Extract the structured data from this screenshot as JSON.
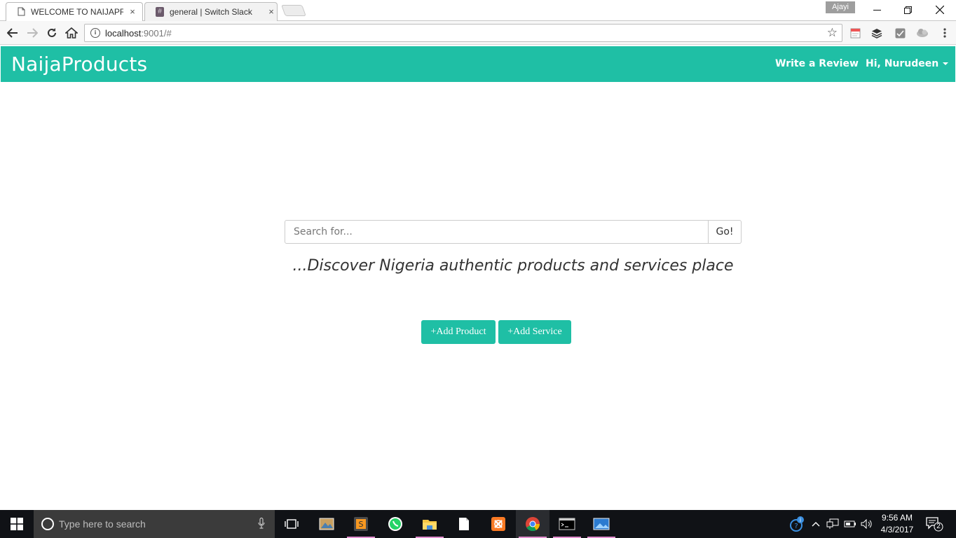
{
  "browser": {
    "tabs": [
      {
        "label": "WELCOME TO NAIJAPRO",
        "active": true
      },
      {
        "label": "general | Switch Slack",
        "active": false
      }
    ],
    "tab_close_glyph": "×",
    "profile_name": "Ajayi",
    "window_controls": {
      "minimize": "—",
      "restore": "❐",
      "close": "✕"
    },
    "address": {
      "host": "localhost",
      "path": ":9001/#"
    },
    "info_glyph": "i",
    "bookmark_glyph": "☆"
  },
  "navbar": {
    "brand": "NaijaProducts",
    "write_review": "Write a Review",
    "user_greeting": "Hi, Nurudeen",
    "background": "#1fbfa5"
  },
  "main": {
    "search_placeholder": "Search for...",
    "go_label": "Go!",
    "tagline": "...Discover Nigeria authentic products and services place",
    "add_product_label": "+Add Product",
    "add_service_label": "+Add Service"
  },
  "taskbar": {
    "search_text": "Type here to search",
    "time": "9:56 AM",
    "date": "4/3/2017",
    "notification_count": "2",
    "apps": [
      "task-view-icon",
      "photo-viewer-icon",
      "sublime-text-icon",
      "whatsapp-icon",
      "file-explorer-icon",
      "notepad-icon",
      "xampp-icon",
      "chrome-icon",
      "command-prompt-icon",
      "photos-icon"
    ]
  }
}
